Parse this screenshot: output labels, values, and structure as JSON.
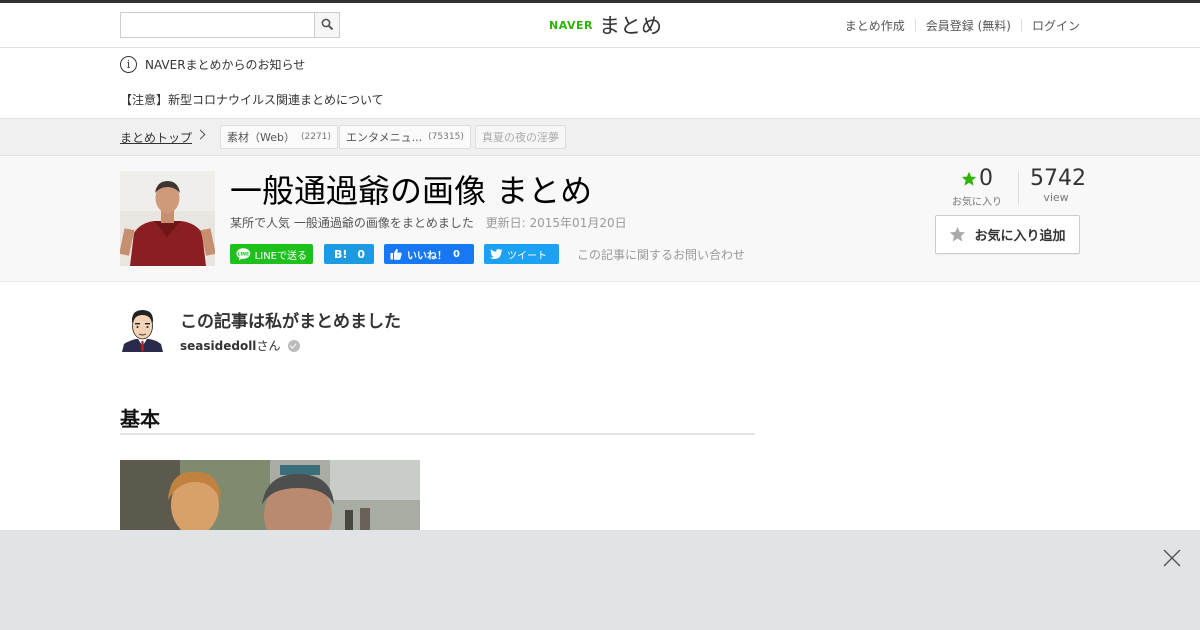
{
  "header": {
    "search": {
      "value": "",
      "placeholder": ""
    },
    "logo": {
      "brand": "NAVER",
      "product": "まとめ"
    },
    "nav": [
      "まとめ作成",
      "会員登録 (無料)",
      "ログイン"
    ]
  },
  "notice": {
    "title": "NAVERまとめからのお知らせ",
    "link": "【注意】新型コロナウイルス関連まとめについて"
  },
  "breadcrumb": {
    "home": "まとめトップ",
    "tags": [
      {
        "label": "素材（Web）",
        "count": "(2271)"
      },
      {
        "label": "エンタメニュ...",
        "count": "(75315)"
      },
      {
        "label": "真夏の夜の淫夢",
        "count": ""
      }
    ]
  },
  "article": {
    "title": "一般通過爺の画像 まとめ",
    "description": "某所で人気 一般通過爺の画像をまとめました",
    "updated": "更新日: 2015年01月20日",
    "share": {
      "line": "LINEで送る",
      "hatena_mark": "B!",
      "hatena_count": "0",
      "facebook": "いいね！",
      "facebook_count": "0",
      "twitter": "ツイート"
    },
    "inquiry": "この記事に関するお問い合わせ",
    "favorites": {
      "count": "0",
      "label": "お気に入り"
    },
    "views": {
      "count": "5742",
      "label": "view"
    },
    "fav_button": "お気に入り追加"
  },
  "author": {
    "heading": "この記事は私がまとめました",
    "name": "seasidedoll",
    "suffix": "さん"
  },
  "section": {
    "title": "基本"
  },
  "colors": {
    "brand_green": "#2db400",
    "line_green": "#1dc01d",
    "hatena_blue": "#1c9be2",
    "facebook_blue": "#1877f2",
    "twitter_blue": "#1da1f2",
    "ad_overlay": "#e1e4e7"
  },
  "icons": [
    "search-icon",
    "info-icon",
    "chevron-right-icon",
    "star-icon",
    "verified-icon",
    "close-icon"
  ]
}
